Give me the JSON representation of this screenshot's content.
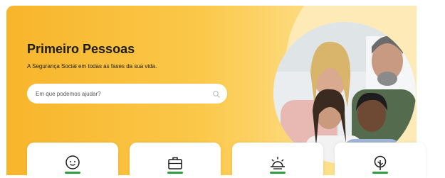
{
  "hero": {
    "title": "Primeiro Pessoas",
    "subtitle": "A Segurança Social em todas as fases da sua vida.",
    "background_colors": [
      "#f7b52b",
      "#fde08c"
    ]
  },
  "search": {
    "placeholder": "Em que podemos ajudar?",
    "value": "",
    "icon": "search-icon"
  },
  "categories": [
    {
      "icon": "baby-face-icon"
    },
    {
      "icon": "briefcase-icon"
    },
    {
      "icon": "sunset-icon"
    },
    {
      "icon": "tree-icon"
    }
  ],
  "accent_color": "#2e9e3e"
}
